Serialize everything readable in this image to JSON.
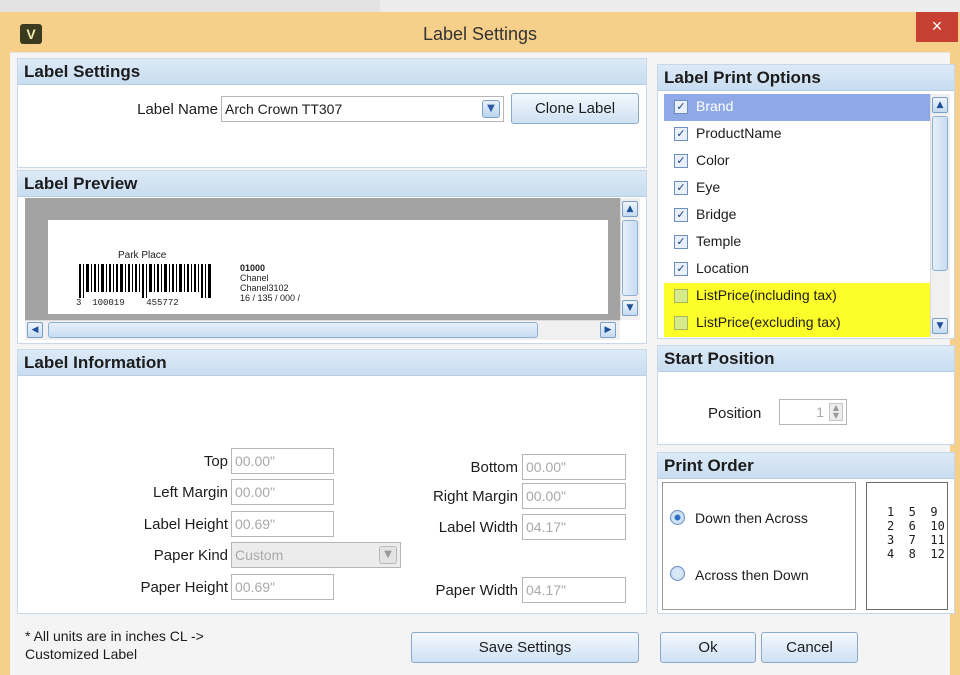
{
  "window": {
    "title": "Label Settings",
    "icon": "V",
    "close_glyph": "×"
  },
  "label_settings": {
    "header": "Label Settings",
    "label_name_label": "Label Name",
    "label_name_value": "Arch Crown TT307",
    "clone_button": "Clone Label"
  },
  "label_preview": {
    "header": "Label Preview",
    "brand": "Park Place",
    "barcode_text": "3  100019    455772",
    "line1": "01000",
    "line2": "Chanel",
    "line3": "Chanel3102",
    "line4": "16 / 135 / 000 /"
  },
  "label_information": {
    "header": "Label Information",
    "top_label": "Top",
    "top_value": "00.00\"",
    "left_margin_label": "Left Margin",
    "left_margin_value": "00.00\"",
    "label_height_label": "Label Height",
    "label_height_value": "00.69\"",
    "paper_kind_label": "Paper Kind",
    "paper_kind_value": "Custom",
    "paper_height_label": "Paper Height",
    "paper_height_value": "00.69\"",
    "bottom_label": "Bottom",
    "bottom_value": "00.00\"",
    "right_margin_label": "Right Margin",
    "right_margin_value": "00.00\"",
    "label_width_label": "Label Width",
    "label_width_value": "04.17\"",
    "paper_width_label": "Paper Width",
    "paper_width_value": "04.17\""
  },
  "footer": {
    "note_line1": "* All units are in inches CL ->",
    "note_line2": "Customized Label",
    "save_button": "Save Settings",
    "ok_button": "Ok",
    "cancel_button": "Cancel"
  },
  "print_options": {
    "header": "Label Print Options",
    "items": [
      {
        "label": "Brand",
        "checked": true,
        "state": "selected"
      },
      {
        "label": "ProductName",
        "checked": true,
        "state": ""
      },
      {
        "label": "Color",
        "checked": true,
        "state": ""
      },
      {
        "label": "Eye",
        "checked": true,
        "state": ""
      },
      {
        "label": "Bridge",
        "checked": true,
        "state": ""
      },
      {
        "label": "Temple",
        "checked": true,
        "state": ""
      },
      {
        "label": "Location",
        "checked": true,
        "state": ""
      },
      {
        "label": "ListPrice(including tax)",
        "checked": false,
        "state": "highlight"
      },
      {
        "label": "ListPrice(excluding tax)",
        "checked": false,
        "state": "highlight"
      }
    ]
  },
  "start_position": {
    "header": "Start Position",
    "position_label": "Position",
    "position_value": "1"
  },
  "print_order": {
    "header": "Print Order",
    "option1": "Down then Across",
    "option2": "Across then Down",
    "selected": "Down then Across",
    "grid": [
      "1  5  9",
      "2  6  10",
      "3  7  11",
      "4  8  12"
    ]
  },
  "colors": {
    "title_bar": "#f6d08a",
    "header_blue": "#c8ddf1",
    "highlight_yellow": "#fdfd2a",
    "close_red": "#c84032"
  }
}
